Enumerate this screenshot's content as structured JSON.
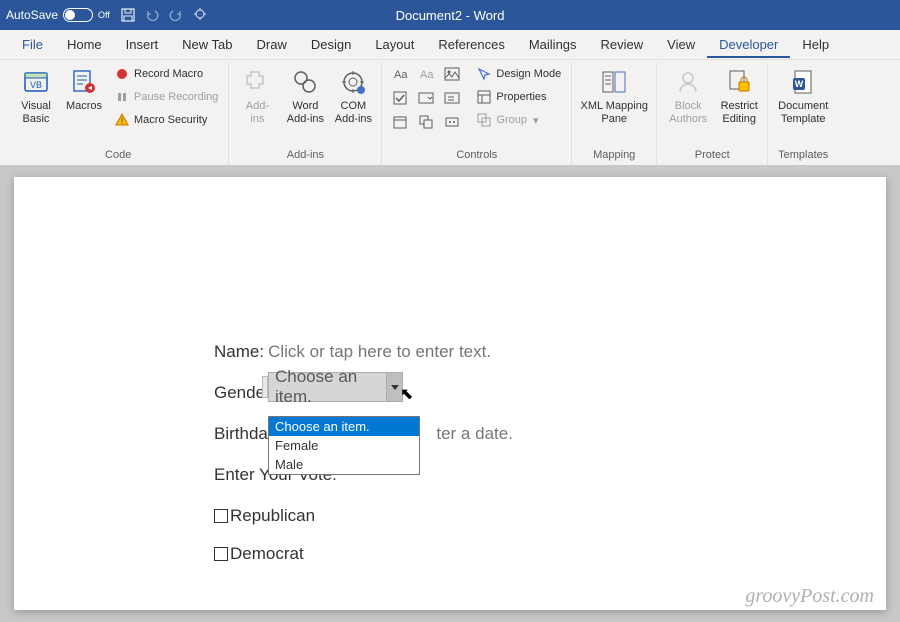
{
  "title": {
    "autosave": "AutoSave",
    "autosave_state": "Off",
    "doc": "Document2 - Word"
  },
  "menu": {
    "file": "File",
    "home": "Home",
    "insert": "Insert",
    "newtab": "New Tab",
    "draw": "Draw",
    "design": "Design",
    "layout": "Layout",
    "references": "References",
    "mailings": "Mailings",
    "review": "Review",
    "view": "View",
    "developer": "Developer",
    "help": "Help"
  },
  "ribbon": {
    "code": {
      "label": "Code",
      "vb": "Visual\nBasic",
      "macros": "Macros",
      "record": "Record Macro",
      "pause": "Pause Recording",
      "security": "Macro Security"
    },
    "addins": {
      "label": "Add-ins",
      "addins_btn": "Add-\nins",
      "word": "Word\nAdd-ins",
      "com": "COM\nAdd-ins"
    },
    "controls": {
      "label": "Controls",
      "design": "Design Mode",
      "props": "Properties",
      "group": "Group"
    },
    "mapping": {
      "label": "Mapping",
      "xml": "XML Mapping\nPane"
    },
    "protect": {
      "label": "Protect",
      "block": "Block\nAuthors",
      "restrict": "Restrict\nEditing"
    },
    "templates": {
      "label": "Templates",
      "doc": "Document\nTemplate"
    }
  },
  "form": {
    "name_label": "Name:",
    "name_placeholder": "Click or tap here to enter text.",
    "gender_label": "Gender:",
    "gender_placeholder": "Choose an item.",
    "birthday_label": "Birthday",
    "birthday_placeholder": "ter a date.",
    "vote_label": "Enter Your Vote:",
    "opt1": "Republican",
    "opt2": "Democrat"
  },
  "dropdown": {
    "opt0": "Choose an item.",
    "opt1": "Female",
    "opt2": "Male"
  },
  "watermark": "groovyPost.com"
}
